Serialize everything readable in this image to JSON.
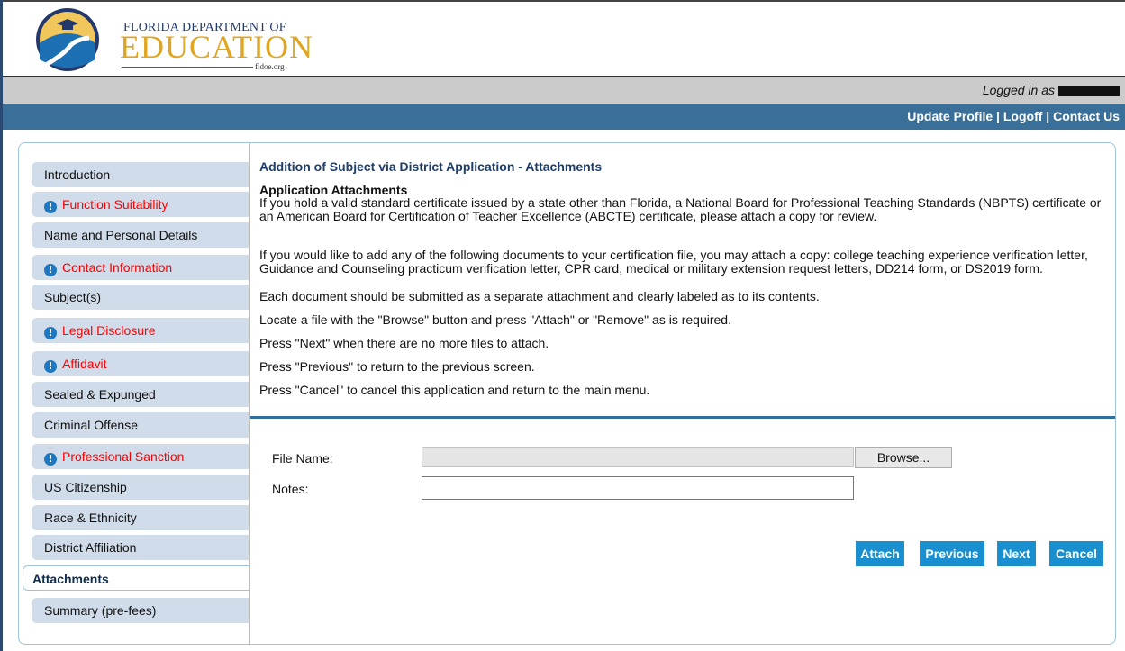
{
  "header": {
    "logo_line1": "FLORIDA DEPARTMENT OF",
    "logo_line2": "EDUCATION",
    "logo_line3": "fldoe.org"
  },
  "user_bar": {
    "logged_in_label": "Logged in as"
  },
  "top_links": {
    "update_profile": "Update Profile",
    "logoff": "Logoff",
    "contact_us": "Contact Us",
    "separator": "|"
  },
  "sidebar": {
    "items": [
      {
        "label": "Introduction",
        "alert": false
      },
      {
        "label": "Function Suitability",
        "alert": true
      },
      {
        "label": "Name and Personal Details",
        "alert": false
      },
      {
        "label": "Contact Information",
        "alert": true
      },
      {
        "label": "Subject(s)",
        "alert": false
      },
      {
        "label": "Legal Disclosure",
        "alert": true
      },
      {
        "label": "Affidavit",
        "alert": true
      },
      {
        "label": "Sealed & Expunged",
        "alert": false
      },
      {
        "label": "Criminal Offense",
        "alert": false
      },
      {
        "label": "Professional Sanction",
        "alert": true
      },
      {
        "label": "US Citizenship",
        "alert": false
      },
      {
        "label": "Race & Ethnicity",
        "alert": false
      },
      {
        "label": "District Affiliation",
        "alert": false
      },
      {
        "label": "Attachments",
        "alert": false,
        "active": true
      },
      {
        "label": "Summary (pre-fees)",
        "alert": false
      }
    ]
  },
  "main": {
    "title": "Addition of Subject via District Application - Attachments",
    "section_heading": "Application Attachments",
    "para1": "If you hold a valid standard certificate issued by a state other than Florida, a National Board for Professional Teaching Standards (NBPTS) certificate or an American Board for Certification of Teacher Excellence (ABCTE) certificate, please attach a copy for review.",
    "para2": "If you would like to add any of the following documents to your certification file, you may attach a copy: college teaching experience verification letter, Guidance and Counseling practicum verification letter, CPR card, medical or military extension request letters, DD214 form, or DS2019 form.",
    "para3": "Each document should be submitted as a separate attachment and clearly labeled as to its contents.",
    "para4": "Locate a file with the \"Browse\" button and press \"Attach\" or \"Remove\" as is required.",
    "para5": "Press \"Next\" when there are no more files to attach.",
    "para6": "Press \"Previous\" to return to the previous screen.",
    "para7": "Press \"Cancel\" to cancel this application and return to the main menu."
  },
  "form": {
    "file_name_label": "File Name:",
    "browse_label": "Browse...",
    "notes_label": "Notes:",
    "file_value": "",
    "notes_value": ""
  },
  "buttons": {
    "attach": "Attach",
    "previous": "Previous",
    "next": "Next",
    "cancel": "Cancel"
  },
  "colors": {
    "brand_blue": "#3a6f9a",
    "button_blue": "#1a8fcf",
    "alert_red": "#ff0000",
    "nav_bg": "#d0dcea"
  },
  "icons": {
    "alert": "info-icon"
  }
}
